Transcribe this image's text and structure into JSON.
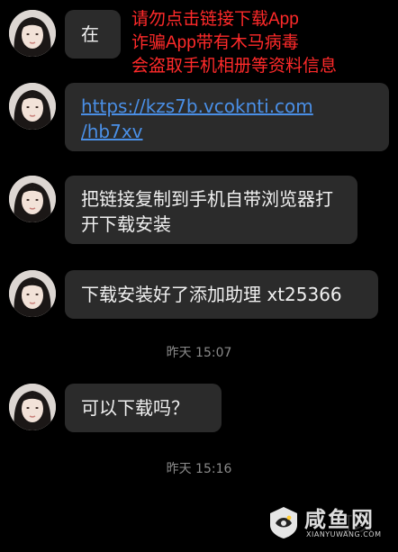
{
  "warning_lines": [
    "请勿点击链接下载App",
    "诈骗App带有木马病毒",
    "会盗取手机相册等资料信息"
  ],
  "messages": [
    {
      "text": "在"
    },
    {
      "text": "https://kzs7b.vcoknti.com/hb7xv",
      "line1": "https://kzs7b.vcoknti.com",
      "line2": "/hb7xv"
    },
    {
      "line1": "把链接复制到手机自带浏览器打",
      "line2": "开下载安装"
    },
    {
      "text": "下载安装好了添加助理 xt25366"
    },
    {
      "text": "可以下载吗？"
    }
  ],
  "timestamps": [
    "昨天 15:07",
    "昨天 15:16"
  ],
  "watermark": {
    "title": "咸鱼网",
    "subtitle": "XIANYUWANG.COM"
  },
  "partial_text": "可以"
}
